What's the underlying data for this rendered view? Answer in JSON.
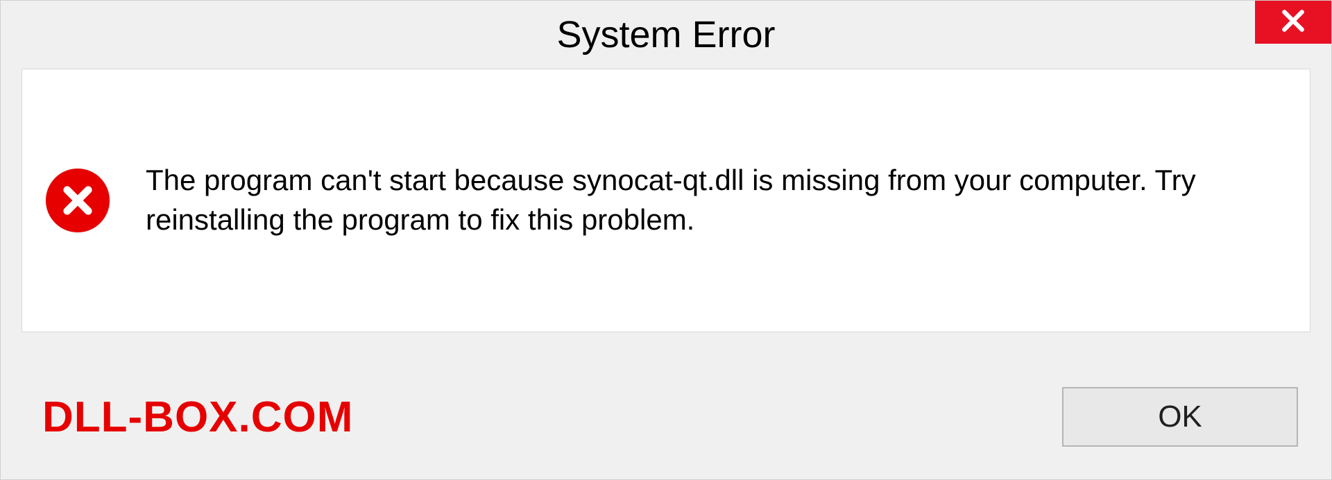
{
  "titlebar": {
    "title": "System Error"
  },
  "content": {
    "message": "The program can't start because synocat-qt.dll is missing from your computer. Try reinstalling the program to fix this problem."
  },
  "footer": {
    "watermark": "DLL-BOX.COM",
    "ok_label": "OK"
  }
}
